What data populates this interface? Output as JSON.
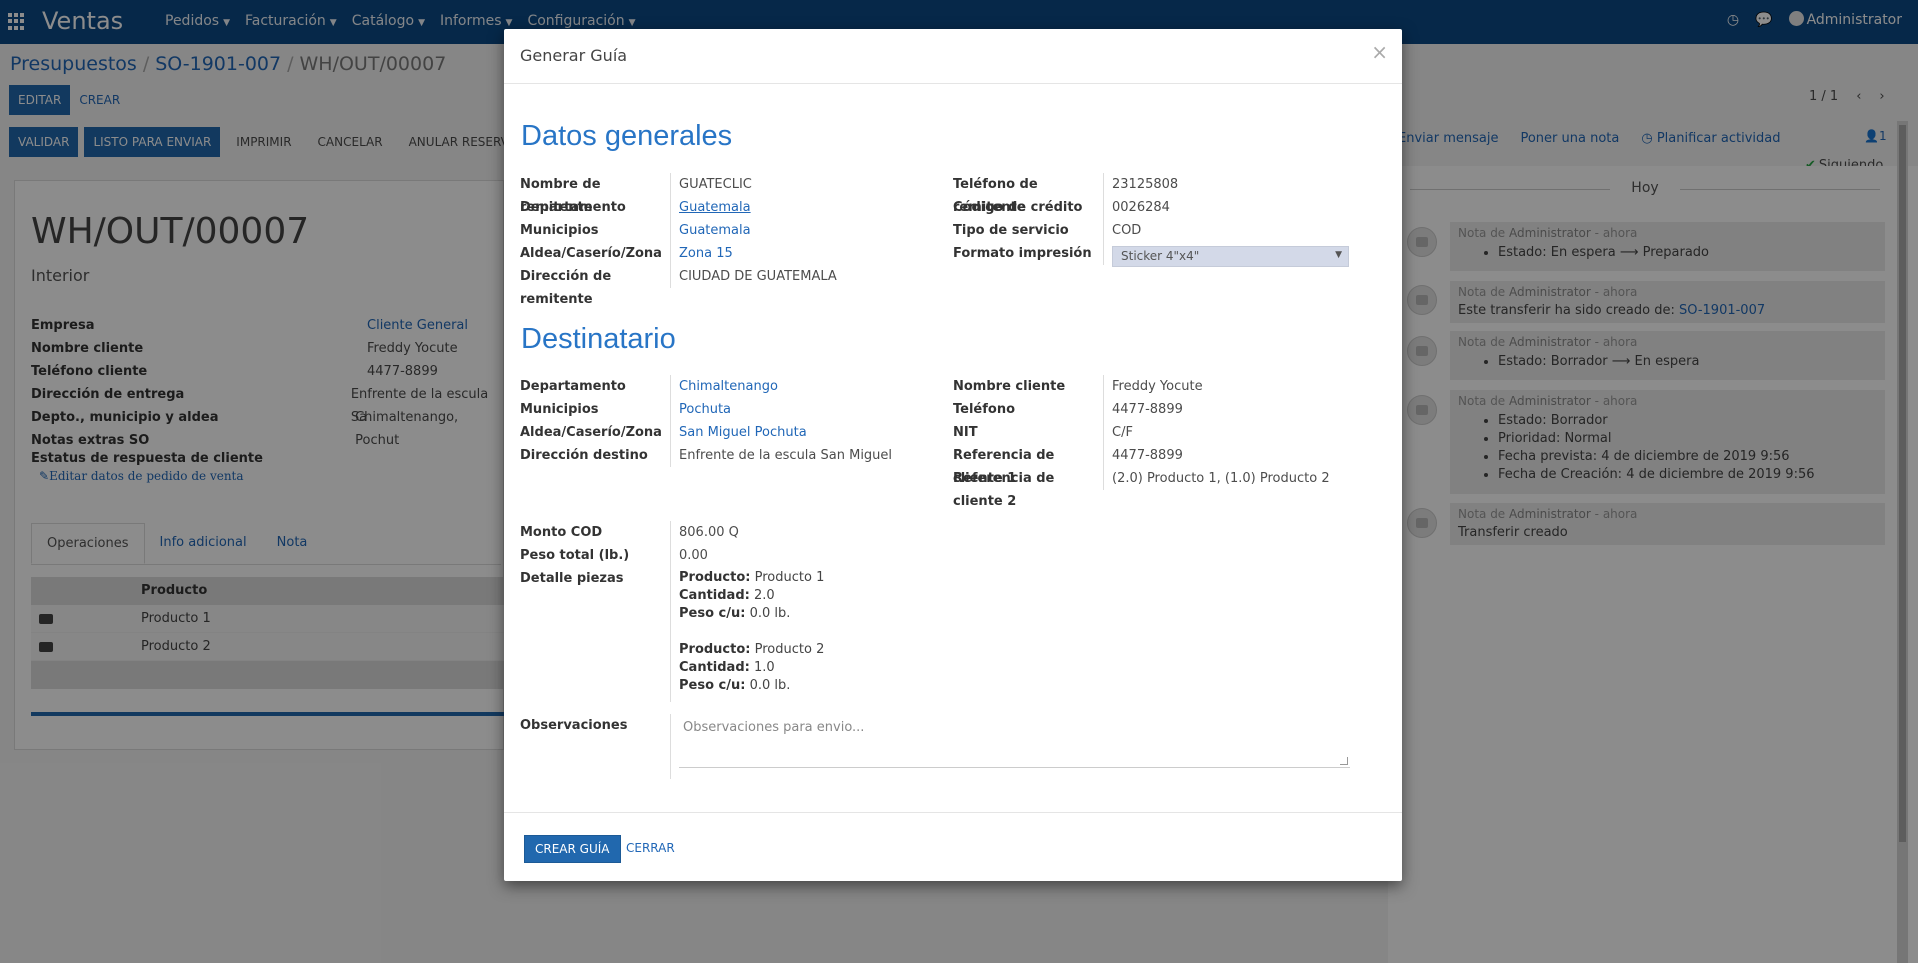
{
  "app": {
    "brand": "Ventas",
    "menu": [
      "Pedidos",
      "Facturación",
      "Catálogo",
      "Informes",
      "Configuración"
    ],
    "user": "Administrator"
  },
  "breadcrumb": [
    "Presupuestos",
    "SO-1901-007",
    "WH/OUT/00007"
  ],
  "control_panel": {
    "edit": "Editar",
    "create": "Crear",
    "pager": "1 / 1"
  },
  "status_buttons": {
    "validate": "Validar",
    "ready": "Listo para enviar",
    "print": "Imprimir",
    "cancel": "Cancelar",
    "unreserve": "Anular reserva"
  },
  "chatter_top": {
    "send": "Enviar mensaje",
    "note": "Poner una nota",
    "activity": "Planificar actividad",
    "followers": "1",
    "following": "Siguiendo"
  },
  "sheet": {
    "title": "WH/OUT/00007",
    "subtitle": "Interior",
    "fields": [
      {
        "label": "Empresa",
        "value": "Cliente General",
        "link": true
      },
      {
        "label": "Nombre cliente",
        "value": "Freddy Yocute"
      },
      {
        "label": "Teléfono cliente",
        "value": "4477-8899"
      },
      {
        "label": "Dirección de entrega",
        "value": "Enfrente de la escula Sa"
      },
      {
        "label": "Depto., municipio y aldea",
        "value": "Chimaltenango, Pochut"
      },
      {
        "label": "Notas extras SO",
        "value": ""
      },
      {
        "label": "Estatus de respuesta de cliente",
        "value": ""
      }
    ],
    "edit_link": "Editar datos de pedido de venta",
    "tabs": [
      "Operaciones",
      "Info adicional",
      "Nota"
    ],
    "table_header": "Producto",
    "products": [
      "Producto 1",
      "Producto 2"
    ]
  },
  "chatter": {
    "day": "Hoy",
    "messages": [
      {
        "author": "Administrator",
        "time": "ahora",
        "items": [
          "Estado: En espera ⟶ Preparado"
        ]
      },
      {
        "author": "Administrator",
        "time": "ahora",
        "body": "Este transferir ha sido creado de:",
        "link": "SO-1901-007"
      },
      {
        "author": "Administrator",
        "time": "ahora",
        "items": [
          "Estado: Borrador ⟶ En espera"
        ]
      },
      {
        "author": "Administrator",
        "time": "ahora",
        "items": [
          "Estado: Borrador",
          "Prioridad: Normal",
          "Fecha prevista: 4 de diciembre de 2019 9:56",
          "Fecha de Creación: 4 de diciembre de 2019 9:56"
        ]
      },
      {
        "author": "Administrator",
        "time": "ahora",
        "body": "Transferir creado"
      }
    ],
    "note_prefix": "Nota de",
    "time_prefix": "- "
  },
  "modal": {
    "title": "Generar Guía",
    "close": "×",
    "general_title": "Datos generales",
    "general_left": [
      {
        "label": "Nombre de remitente",
        "value": "GUATECLIC"
      },
      {
        "label": "Departamento",
        "value": "Guatemala",
        "style": "ulink"
      },
      {
        "label": "Municipios",
        "value": "Guatemala",
        "style": "link"
      },
      {
        "label": "Aldea/Caserío/Zona",
        "value": "Zona 15",
        "style": "link"
      },
      {
        "label": "Dirección de remitente",
        "value": "CIUDAD DE GUATEMALA"
      }
    ],
    "general_right": [
      {
        "label": "Teléfono de remitente",
        "value": "23125808"
      },
      {
        "label": "Código de crédito",
        "value": "0026284"
      },
      {
        "label": "Tipo de servicio",
        "value": "COD"
      },
      {
        "label": "Formato impresión",
        "value": ""
      }
    ],
    "format_select": "Sticker 4\"x4\"",
    "dest_title": "Destinatario",
    "dest_left": [
      {
        "label": "Departamento",
        "value": "Chimaltenango",
        "style": "link"
      },
      {
        "label": "Municipios",
        "value": "Pochuta",
        "style": "link"
      },
      {
        "label": "Aldea/Caserío/Zona",
        "value": "San Miguel Pochuta",
        "style": "link"
      },
      {
        "label": "Dirección destino",
        "value": "Enfrente de la escula San Miguel"
      }
    ],
    "dest_right": [
      {
        "label": "Nombre cliente",
        "value": "Freddy Yocute"
      },
      {
        "label": "Teléfono",
        "value": "4477-8899"
      },
      {
        "label": "NIT",
        "value": "C/F"
      },
      {
        "label": "Referencia de cliente 1",
        "value": "4477-8899"
      },
      {
        "label": "Referencia de cliente 2",
        "value": "(2.0) Producto 1, (1.0) Producto 2"
      }
    ],
    "cod": [
      {
        "label": "Monto COD",
        "value": "806.00 Q"
      },
      {
        "label": "Peso total (lb.)",
        "value": "0.00"
      },
      {
        "label": "Detalle piezas",
        "value": ""
      }
    ],
    "pieces": [
      {
        "producto": "Producto 1",
        "cantidad": "2.0",
        "peso": "0.0 lb."
      },
      {
        "producto": "Producto 2",
        "cantidad": "1.0",
        "peso": "0.0 lb."
      }
    ],
    "pieces_labels": {
      "producto": "Producto:",
      "cantidad": "Cantidad:",
      "peso": "Peso c/u:"
    },
    "obs_label": "Observaciones",
    "obs_placeholder": "Observaciones para envio...",
    "create_btn": "Crear guía",
    "close_btn": "Cerrar"
  }
}
